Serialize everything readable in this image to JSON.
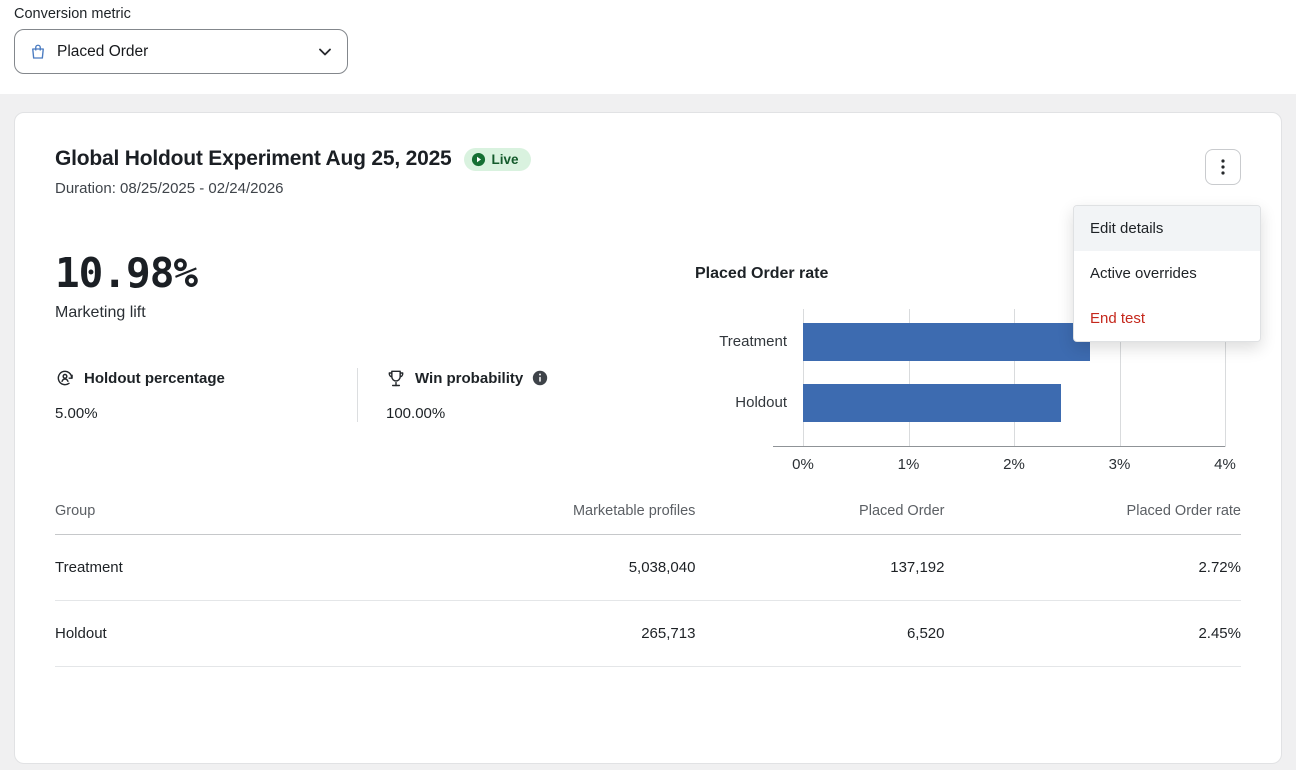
{
  "top": {
    "conversion_metric_label": "Conversion metric",
    "metric_value": "Placed Order"
  },
  "card": {
    "title": "Global Holdout Experiment Aug 25, 2025",
    "live_label": "Live",
    "duration": "Duration: 08/25/2025 - 02/24/2026",
    "lift_value": "10.98%",
    "lift_label": "Marketing lift",
    "stats": [
      {
        "label": "Holdout percentage",
        "value": "5.00%"
      },
      {
        "label": "Win probability",
        "value": "100.00%"
      }
    ],
    "menu_items": [
      {
        "label": "Edit details",
        "highlighted": true,
        "danger": false
      },
      {
        "label": "Active overrides",
        "highlighted": false,
        "danger": false
      },
      {
        "label": "End test",
        "highlighted": false,
        "danger": true
      }
    ]
  },
  "chart_data": {
    "type": "bar",
    "orientation": "horizontal",
    "title": "Placed Order rate",
    "categories": [
      "Treatment",
      "Holdout"
    ],
    "values": [
      2.72,
      2.45
    ],
    "xlim": [
      0,
      4
    ],
    "x_ticks": [
      {
        "value": 0,
        "label": "0%"
      },
      {
        "value": 1,
        "label": "1%"
      },
      {
        "value": 2,
        "label": "2%"
      },
      {
        "value": 3,
        "label": "3%"
      },
      {
        "value": 4,
        "label": "4%"
      }
    ],
    "bar_color": "#3d6bb0",
    "grid": true,
    "legend": false
  },
  "table": {
    "headers": [
      "Group",
      "Marketable profiles",
      "Placed Order",
      "Placed Order rate"
    ],
    "rows": [
      [
        "Treatment",
        "5,038,040",
        "137,192",
        "2.72%"
      ],
      [
        "Holdout",
        "265,713",
        "6,520",
        "2.45%"
      ]
    ]
  },
  "colors": {
    "bar": "#3d6bb0",
    "live_badge_bg": "#d9f2df",
    "live_badge_text": "#135a2b",
    "danger_text": "#c5281c",
    "background_gray": "#f0f0f1"
  }
}
